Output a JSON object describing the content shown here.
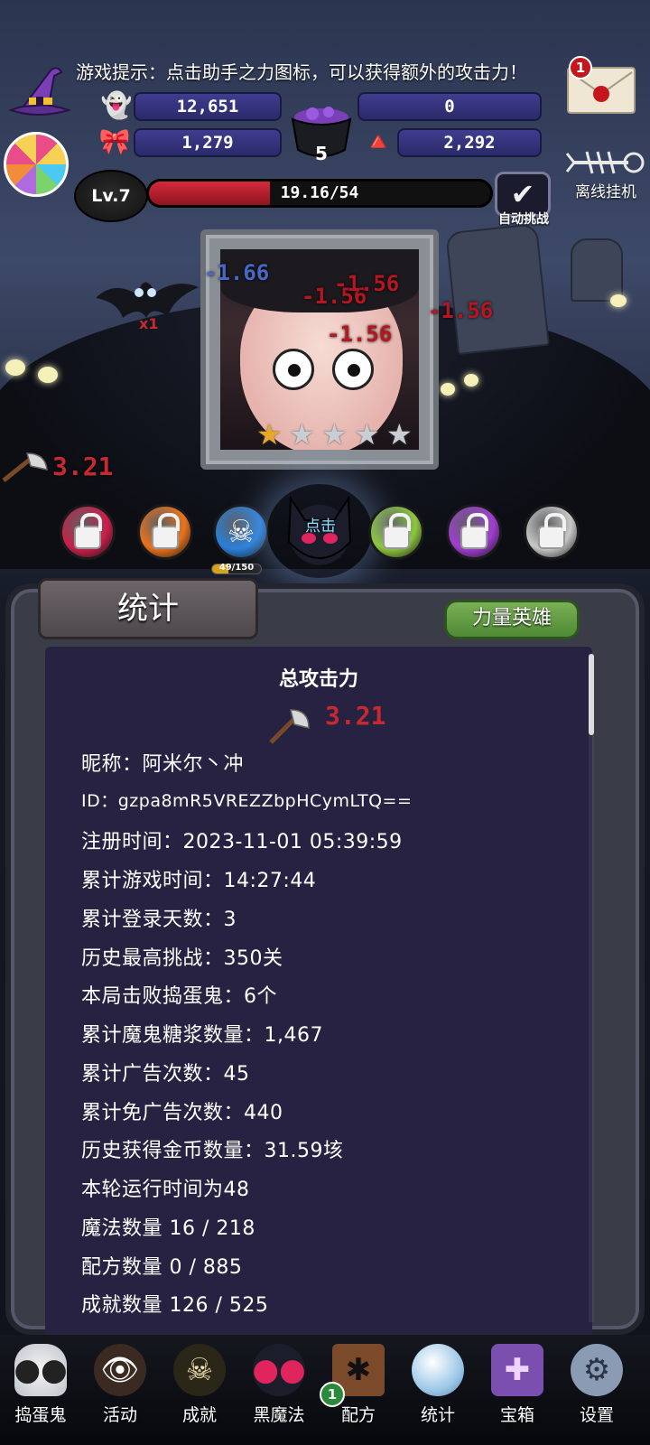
{
  "hint": "游戏提示：点击助手之力图标，可以获得额外的攻击力！",
  "resources": {
    "ghost_candy": "12,651",
    "skull_potion": "0",
    "bow_candy": "1,279",
    "candy_corn": "2,292",
    "cauldron_count": "5"
  },
  "mail": {
    "badge": "1"
  },
  "offline": {
    "label": "离线挂机"
  },
  "level": {
    "label": "Lv.7",
    "hp_text": "19.16/54",
    "hp_fraction": 0.355
  },
  "auto_challenge": {
    "label": "自动挑战",
    "checked": true,
    "check_glyph": "✔"
  },
  "battle": {
    "damage_numbers": [
      "-1.66",
      "-1.56",
      "-1.56",
      "-1.56",
      "-1.56"
    ],
    "bat_multiplier": "x1",
    "stars_filled": 1,
    "stars_total": 5,
    "attack_value": "3.21"
  },
  "skills": {
    "orb_progress_text": "49/150",
    "orb_progress_fraction": 0.327,
    "click_label": "点击",
    "orb_colors": [
      "#c8204a",
      "#e8731c",
      "#2a7fd8",
      "#8cc63f",
      "#a03ed0",
      "#c8c8c8"
    ]
  },
  "panel": {
    "tab_label": "统计",
    "hero_button": "力量英雄",
    "title": "总攻击力",
    "total_attack": "3.21",
    "rows": [
      "昵称：阿米尔丶冲",
      "ID：gzpa8mR5VREZZbpHCymLTQ==",
      "注册时间：2023-11-01 05:39:59",
      "累计游戏时间：14:27:44",
      "累计登录天数：3",
      "历史最高挑战：350关",
      "本局击败捣蛋鬼：6个",
      "累计魔鬼糖浆数量：1,467",
      "累计广告次数：45",
      "累计免广告次数：440",
      "历史获得金币数量：31.59垓",
      "本轮运行时间为48",
      "魔法数量 16 / 218",
      "配方数量 0 / 885",
      "成就数量 126 / 525"
    ]
  },
  "nav": {
    "items": [
      {
        "label": "捣蛋鬼",
        "icon": "ghost-icon"
      },
      {
        "label": "活动",
        "icon": "eyeball-basket-icon"
      },
      {
        "label": "成就",
        "icon": "skull-trophy-icon"
      },
      {
        "label": "黑魔法",
        "icon": "demon-icon"
      },
      {
        "label": "配方",
        "icon": "recipe-book-icon"
      },
      {
        "label": "统计",
        "icon": "crystal-ball-icon"
      },
      {
        "label": "宝箱",
        "icon": "treasure-chest-icon"
      },
      {
        "label": "设置",
        "icon": "gear-icon"
      }
    ],
    "recipe_badge": "1"
  }
}
